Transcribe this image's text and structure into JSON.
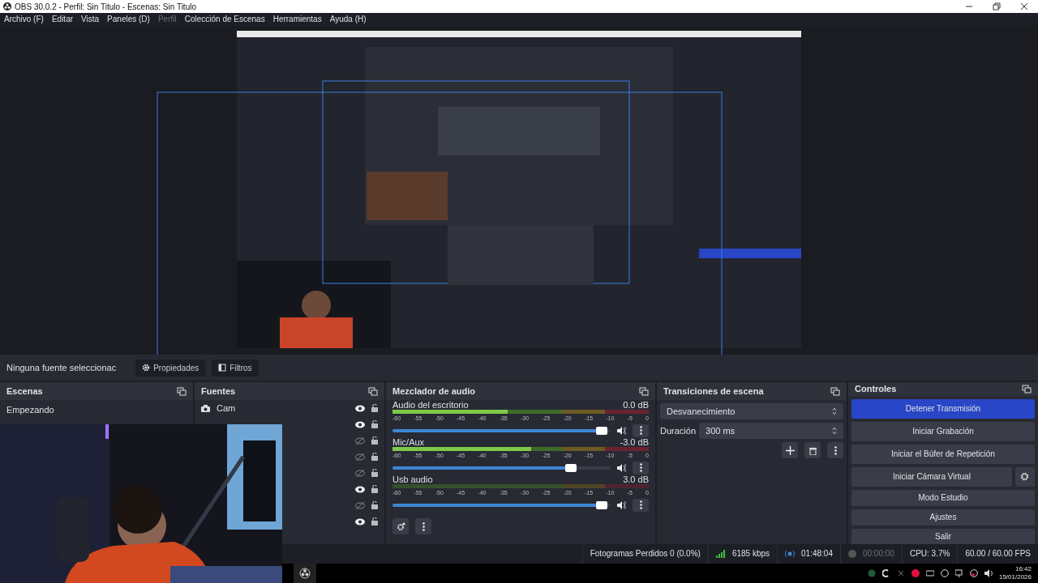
{
  "window": {
    "title": "OBS 30.0.2 - Perfil: Sin Titulo - Escenas: Sin Titulo"
  },
  "menu": [
    {
      "label": "Archivo (F)",
      "disabled": false
    },
    {
      "label": "Editar",
      "disabled": false
    },
    {
      "label": "Vista",
      "disabled": false
    },
    {
      "label": "Paneles (D)",
      "disabled": false
    },
    {
      "label": "Perfil",
      "disabled": true
    },
    {
      "label": "Colección de Escenas",
      "disabled": false
    },
    {
      "label": "Herramientas",
      "disabled": false
    },
    {
      "label": "Ayuda (H)",
      "disabled": false
    }
  ],
  "context_bar": {
    "source": "Ninguna fuente seleccionac",
    "buttons": [
      "Propiedades",
      "Filtros"
    ]
  },
  "scenes": {
    "title": "Escenas",
    "items": [
      {
        "name": "Empezando",
        "selected": false
      }
    ]
  },
  "sources": {
    "title": "Fuentes",
    "items": [
      {
        "name": "Cam",
        "visible": true,
        "locked": false
      },
      {
        "visible": true,
        "locked": false
      },
      {
        "visible": false,
        "locked": false
      },
      {
        "visible": false,
        "locked": false
      },
      {
        "visible": false,
        "locked": false
      },
      {
        "visible": true,
        "locked": false
      },
      {
        "visible": false,
        "locked": false
      },
      {
        "visible": true,
        "locked": false
      }
    ]
  },
  "mixer": {
    "title": "Mezclador de audio",
    "channels": [
      {
        "name": "Audio del escritorio",
        "reading": "0.0 dB",
        "level": 0.97,
        "meter": {
          "level": 0.45
        },
        "scale": [
          "-60",
          "-55",
          "-50",
          "-45",
          "-40",
          "-35",
          "-30",
          "-25",
          "-20",
          "-15",
          "-10",
          "-5",
          "0"
        ]
      },
      {
        "name": "Mic/Aux",
        "reading": "-3.0 dB",
        "level": 0.83,
        "meter": {
          "level": 0.54
        },
        "scale": [
          "-60",
          "-55",
          "-50",
          "-45",
          "-40",
          "-35",
          "-30",
          "-25",
          "-20",
          "-15",
          "-10",
          "-5",
          "0"
        ]
      },
      {
        "name": "Usb audio",
        "reading": "3.0 dB",
        "level": 0.97,
        "scale": [
          "-60",
          "-55",
          "-50",
          "-45",
          "-40",
          "-35",
          "-30",
          "-25",
          "-20",
          "-15",
          "-10",
          "-5",
          "0"
        ]
      }
    ]
  },
  "transitions": {
    "title": "Transiciones de escena",
    "transition": "Desvanecimiento",
    "duration_label": "Duración",
    "duration": "300 ms"
  },
  "controls": {
    "title": "Controles",
    "buttons": [
      {
        "label": "Detener Transmisión",
        "active": true
      },
      {
        "label": "Iniciar Grabación",
        "active": false
      },
      {
        "label": "Iniciar el Búfer de Repetición",
        "active": false
      },
      {
        "label": "Iniciar Cámara Virtual",
        "active": false
      },
      {
        "label": "Modo Estudio",
        "active": false
      },
      {
        "label": "Ajustes",
        "active": false
      },
      {
        "label": "Salir",
        "active": false
      }
    ]
  },
  "status_bar": {
    "dropped_frames": "Fotogramas Perdidos 0 (0.0%)",
    "bitrate": "6185 kbps",
    "stream_time": "01:48:04",
    "record_time": "00:00:00",
    "cpu": "CPU: 3.7%",
    "fps": "60.00 / 60.00 FPS"
  },
  "taskbar": {
    "time": "16:42",
    "date": "15/01/2026"
  }
}
